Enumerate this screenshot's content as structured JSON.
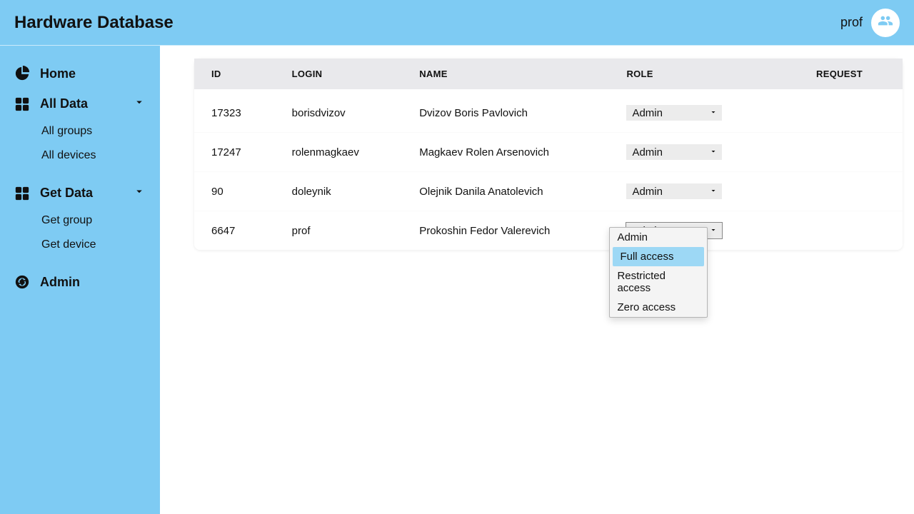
{
  "header": {
    "app_title": "Hardware Database",
    "username": "prof"
  },
  "sidebar": {
    "home": "Home",
    "all_data": "All Data",
    "all_groups": "All groups",
    "all_devices": "All devices",
    "get_data": "Get Data",
    "get_group": "Get group",
    "get_device": "Get device",
    "admin": "Admin"
  },
  "table": {
    "columns": {
      "id": "ID",
      "login": "LOGIN",
      "name": "NAME",
      "role": "ROLE",
      "request": "REQUEST"
    },
    "rows": [
      {
        "id": "17323",
        "login": "borisdvizov",
        "name": "Dvizov Boris Pavlovich",
        "role": "Admin"
      },
      {
        "id": "17247",
        "login": "rolenmagkaev",
        "name": "Magkaev Rolen Arsenovich",
        "role": "Admin"
      },
      {
        "id": "90",
        "login": "doleynik",
        "name": "Olejnik Danila Anatolevich",
        "role": "Admin"
      },
      {
        "id": "6647",
        "login": "prof",
        "name": "Prokoshin Fedor Valerevich",
        "role": "Admin"
      }
    ]
  },
  "role_options": [
    "Admin",
    "Full access",
    "Restricted access",
    "Zero access"
  ],
  "dropdown": {
    "open_row_index": 3,
    "highlighted_option": "Full access"
  }
}
